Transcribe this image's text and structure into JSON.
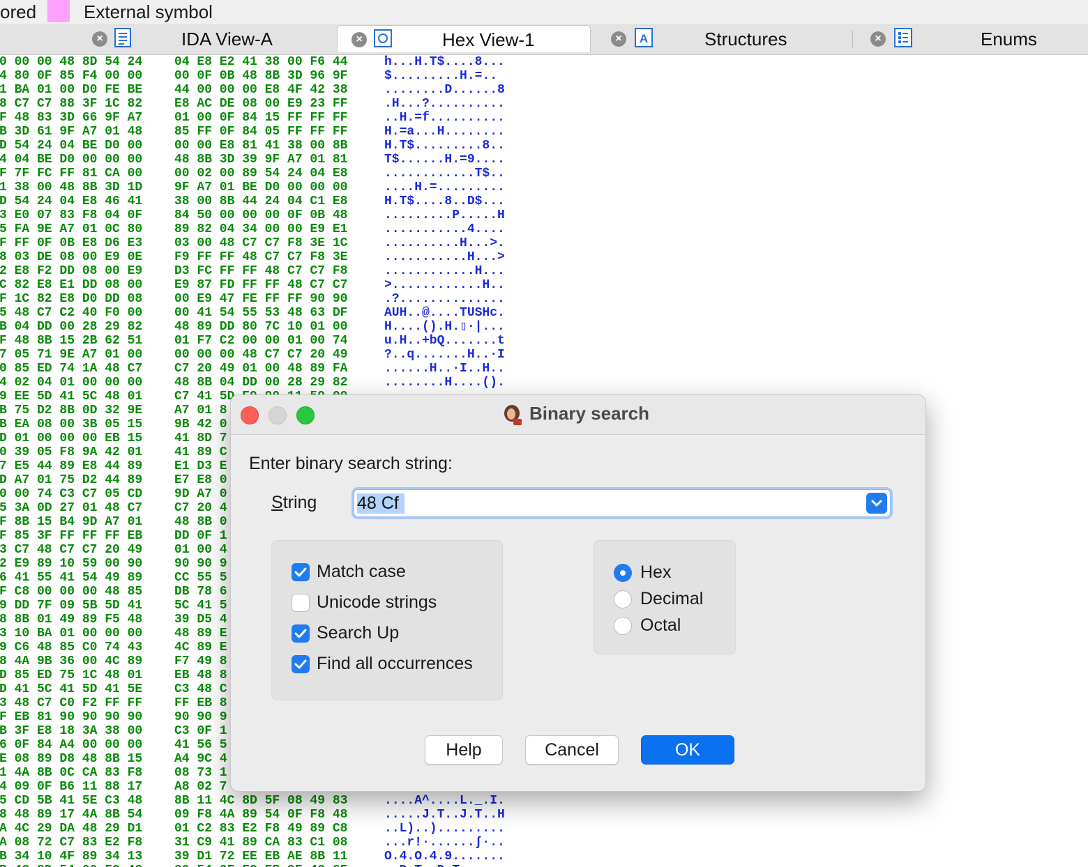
{
  "legend": {
    "partial_label": "ored",
    "external_symbol_label": "External symbol",
    "external_symbol_color": "#ffa0ff"
  },
  "tabs": [
    {
      "label": "IDA View-A",
      "icon": "listing-icon",
      "active": false
    },
    {
      "label": "Hex View-1",
      "icon": "hex-view-icon",
      "active": true
    },
    {
      "label": "Structures",
      "icon": "structures-icon",
      "active": false
    },
    {
      "label": "Enums",
      "icon": "enums-icon",
      "active": false
    }
  ],
  "hex_colors": {
    "bytes": "#0a8a0a",
    "ascii": "#1a2ad8"
  },
  "hex_rows": [
    {
      "b1": "0 00 00 48 8D 54 24",
      "b2": "04 E8 E2 41 38 00 F6 44",
      "asc": "h...H.T$....8..."
    },
    {
      "b1": "4 80 0F 85 F4 00 00",
      "b2": "00 0F 0B 48 8B 3D 96 9F",
      "asc": "$.........H.=.."
    },
    {
      "b1": "1 BA 01 00 D0 FE BE",
      "b2": "44 00 00 00 E8 4F 42 38",
      "asc": "........D......8"
    },
    {
      "b1": "8 C7 C7 88 3F 1C 82",
      "b2": "E8 AC DE 08 00 E9 23 FF",
      "asc": ".H...?.........."
    },
    {
      "b1": "F 48 83 3D 66 9F A7",
      "b2": "01 00 0F 84 15 FF FF FF",
      "asc": "..H.=f.........."
    },
    {
      "b1": "B 3D 61 9F A7 01 48",
      "b2": "85 FF 0F 84 05 FF FF FF",
      "asc": "H.=a...H........"
    },
    {
      "b1": "D 54 24 04 BE D0 00",
      "b2": "00 00 E8 81 41 38 00 8B",
      "asc": "H.T$.........8.."
    },
    {
      "b1": "4 04 BE D0 00 00 00",
      "b2": "48 8B 3D 39 9F A7 01 81",
      "asc": "T$......H.=9...."
    },
    {
      "b1": "F 7F FC FF 81 CA 00",
      "b2": "00 02 00 89 54 24 04 E8",
      "asc": "............T$.."
    },
    {
      "b1": "1 38 00 48 8B 3D 1D",
      "b2": "9F A7 01 BE D0 00 00 00",
      "asc": "....H.=........."
    },
    {
      "b1": "D 54 24 04 E8 46 41",
      "b2": "38 00 8B 44 24 04 C1 E8",
      "asc": "H.T$....8..D$..."
    },
    {
      "b1": "3 E0 07 83 F8 04 0F",
      "b2": "84 50 00 00 00 0F 0B 48",
      "asc": ".........P.....H"
    },
    {
      "b1": "5 FA 9E A7 01 0C 80",
      "b2": "89 82 04 34 00 00 E9 E1",
      "asc": "...........4...."
    },
    {
      "b1": "F FF 0F 0B E8 D6 E3",
      "b2": "03 00 48 C7 C7 F8 3E 1C",
      "asc": "..........H...>."
    },
    {
      "b1": "8 03 DE 08 00 E9 0E",
      "b2": "F9 FF FF 48 C7 C7 F8 3E",
      "asc": "...........H...>"
    },
    {
      "b1": "2 E8 F2 DD 08 00 E9",
      "b2": "D3 FC FF FF 48 C7 C7 F8",
      "asc": "............H..."
    },
    {
      "b1": "C 82 E8 E1 DD 08 00",
      "b2": "E9 87 FD FF FF 48 C7 C7",
      "asc": ">............H.."
    },
    {
      "b1": "F 1C 82 E8 D0 DD 08",
      "b2": "00 E9 47 FE FF FF 90 90",
      "asc": ".?.............."
    },
    {
      "b1": "5 48 C7 C2 40 F0 00",
      "b2": "00 41 54 55 53 48 63 DF",
      "asc": "AUH..@....TUSHc."
    },
    {
      "b1": "B 04 DD 00 28 29 82",
      "b2": "48 89 DD 80 7C 10 01 00",
      "asc": "H....().H.▯·|..."
    },
    {
      "b1": "F 48 8B 15 2B 62 51",
      "b2": "01 F7 C2 00 00 01 00 74",
      "asc": "u.H..+bQ.......t"
    },
    {
      "b1": "7 05 71 9E A7 01 00",
      "b2": "00 00 00 48 C7 C7 20 49",
      "asc": "?..q.......H..·I"
    },
    {
      "b1": "0 85 ED 74 1A 48 C7",
      "b2": "C7 20 49 01 00 48 89 FA",
      "asc": "......H..·I..H.."
    },
    {
      "b1": "4 02 04 01 00 00 00",
      "b2": "48 8B 04 DD 00 28 29 82",
      "asc": "........H....()."
    },
    {
      "b1": "9 EE 5D 41 5C 48 01",
      "b2": "C7 41 5D E9 90 11 59 00",
      "asc": ""
    },
    {
      "b1": "B 75 D2 8B 0D 32 9E",
      "b2": "A7 01 8",
      "asc": ""
    },
    {
      "b1": "B EA 08 00 3B 05 15",
      "b2": "9B 42 0",
      "asc": ""
    },
    {
      "b1": "D 01 00 00 00 EB 15",
      "b2": "41 8D 7",
      "asc": ""
    },
    {
      "b1": "0 39 05 F8 9A 42 01",
      "b2": "41 89 C",
      "asc": ""
    },
    {
      "b1": "7 E5 44 89 E8 44 89",
      "b2": "E1 D3 E",
      "asc": ""
    },
    {
      "b1": "D A7 01 75 D2 44 89",
      "b2": "E7 E8 0",
      "asc": ""
    },
    {
      "b1": "0 00 74 C3 C7 05 CD",
      "b2": "9D A7 0",
      "asc": ""
    },
    {
      "b1": "5 3A 0D 27 01 48 C7",
      "b2": "C7 20 4",
      "asc": ""
    },
    {
      "b1": "F 8B 15 B4 9D A7 01",
      "b2": "48 8B 0",
      "asc": ""
    },
    {
      "b1": "F 85 3F FF FF FF EB",
      "b2": "DD 0F 1",
      "asc": ""
    },
    {
      "b1": "3 C7 48 C7 C7 20 49",
      "b2": "01 00 4",
      "asc": ""
    },
    {
      "b1": "2 E9 89 10 59 00 90",
      "b2": "90 90 9",
      "asc": ""
    },
    {
      "b1": "6 41 55 41 54 49 89",
      "b2": "CC 55 5",
      "asc": ""
    },
    {
      "b1": "F C8 00 00 00 48 85",
      "b2": "DB 78 6",
      "asc": ""
    },
    {
      "b1": "9 DD 7F 09 5B 5D 41",
      "b2": "5C 41 5",
      "asc": ""
    },
    {
      "b1": "8 8B 01 49 89 F5 48",
      "b2": "39 D5 4",
      "asc": ""
    },
    {
      "b1": "3 10 BA 01 00 00 00",
      "b2": "48 89 E",
      "asc": ""
    },
    {
      "b1": "9 C6 48 85 C0 74 43",
      "b2": "4C 89 E",
      "asc": ""
    },
    {
      "b1": "8 4A 9B 36 00 4C 89",
      "b2": "F7 49 8",
      "asc": ""
    },
    {
      "b1": "D 85 ED 75 1C 48 01",
      "b2": "EB 48 8",
      "asc": ""
    },
    {
      "b1": "D 41 5C 41 5D 41 5E",
      "b2": "C3 48 C",
      "asc": ""
    },
    {
      "b1": "3 48 C7 C0 F2 FF FF",
      "b2": "FF EB 8",
      "asc": ""
    },
    {
      "b1": "F EB 81 90 90 90 90",
      "b2": "90 90 9",
      "asc": ""
    },
    {
      "b1": "B 3F E8 18 3A 38 00",
      "b2": "C3 0F 1",
      "asc": ""
    },
    {
      "b1": "6 0F 84 A4 00 00 00",
      "b2": "41 56 5",
      "asc": ""
    },
    {
      "b1": "E 08 89 D8 48 8B 15",
      "b2": "A4 9C 4",
      "asc": ""
    },
    {
      "b1": "1 4A 8B 0C CA 83 F8",
      "b2": "08 73 1",
      "asc": ""
    },
    {
      "b1": "4 09 0F B6 11 88 17",
      "b2": "A8 02 7",
      "asc": ""
    },
    {
      "b1": "5 CD 5B 41 5E C3 48",
      "b2": "8B 11 4C 8D 5F 08 49 83",
      "asc": "....A^....L._.I."
    },
    {
      "b1": "8 48 89 17 4A 8B 54",
      "b2": "09 F8 4A 89 54 0F F8 48",
      "asc": ".....J.T..J.T..H"
    },
    {
      "b1": "A 4C 29 DA 48 29 D1",
      "b2": "01 C2 83 E2 F8 49 89 C8",
      "asc": "..L)..)........."
    },
    {
      "b1": "A 08 72 C7 83 E2 F8",
      "b2": "31 C9 41 89 CA 83 C1 08",
      "asc": "...r!·......ʃ·.."
    },
    {
      "b1": "B 34 10 4F 89 34 13",
      "b2": "39 D1 72 EE EB AE 8B 11",
      "asc": "O.4.O.4.9......."
    },
    {
      "b1": "B 43 8D 54 00 FC 42",
      "b2": "89 54 0F FC EB 9E 43 0F",
      "asc": "..D.T..D.T......"
    }
  ],
  "dialog": {
    "title": "Binary search",
    "prompt": "Enter binary search string:",
    "string_label_mnemonic": "S",
    "string_label_rest": "tring",
    "string_value": "48 Cf",
    "options": [
      {
        "label": "Match case",
        "checked": true
      },
      {
        "label": "Unicode strings",
        "checked": false
      },
      {
        "label": "Search Up",
        "checked": true
      },
      {
        "label": "Find all occurrences",
        "checked": true
      }
    ],
    "radix": [
      {
        "label": "Hex",
        "selected": true
      },
      {
        "label": "Decimal",
        "selected": false
      },
      {
        "label": "Octal",
        "selected": false
      }
    ],
    "buttons": {
      "help": "Help",
      "cancel": "Cancel",
      "ok": "OK"
    },
    "accent_color": "#1f7cf0"
  }
}
